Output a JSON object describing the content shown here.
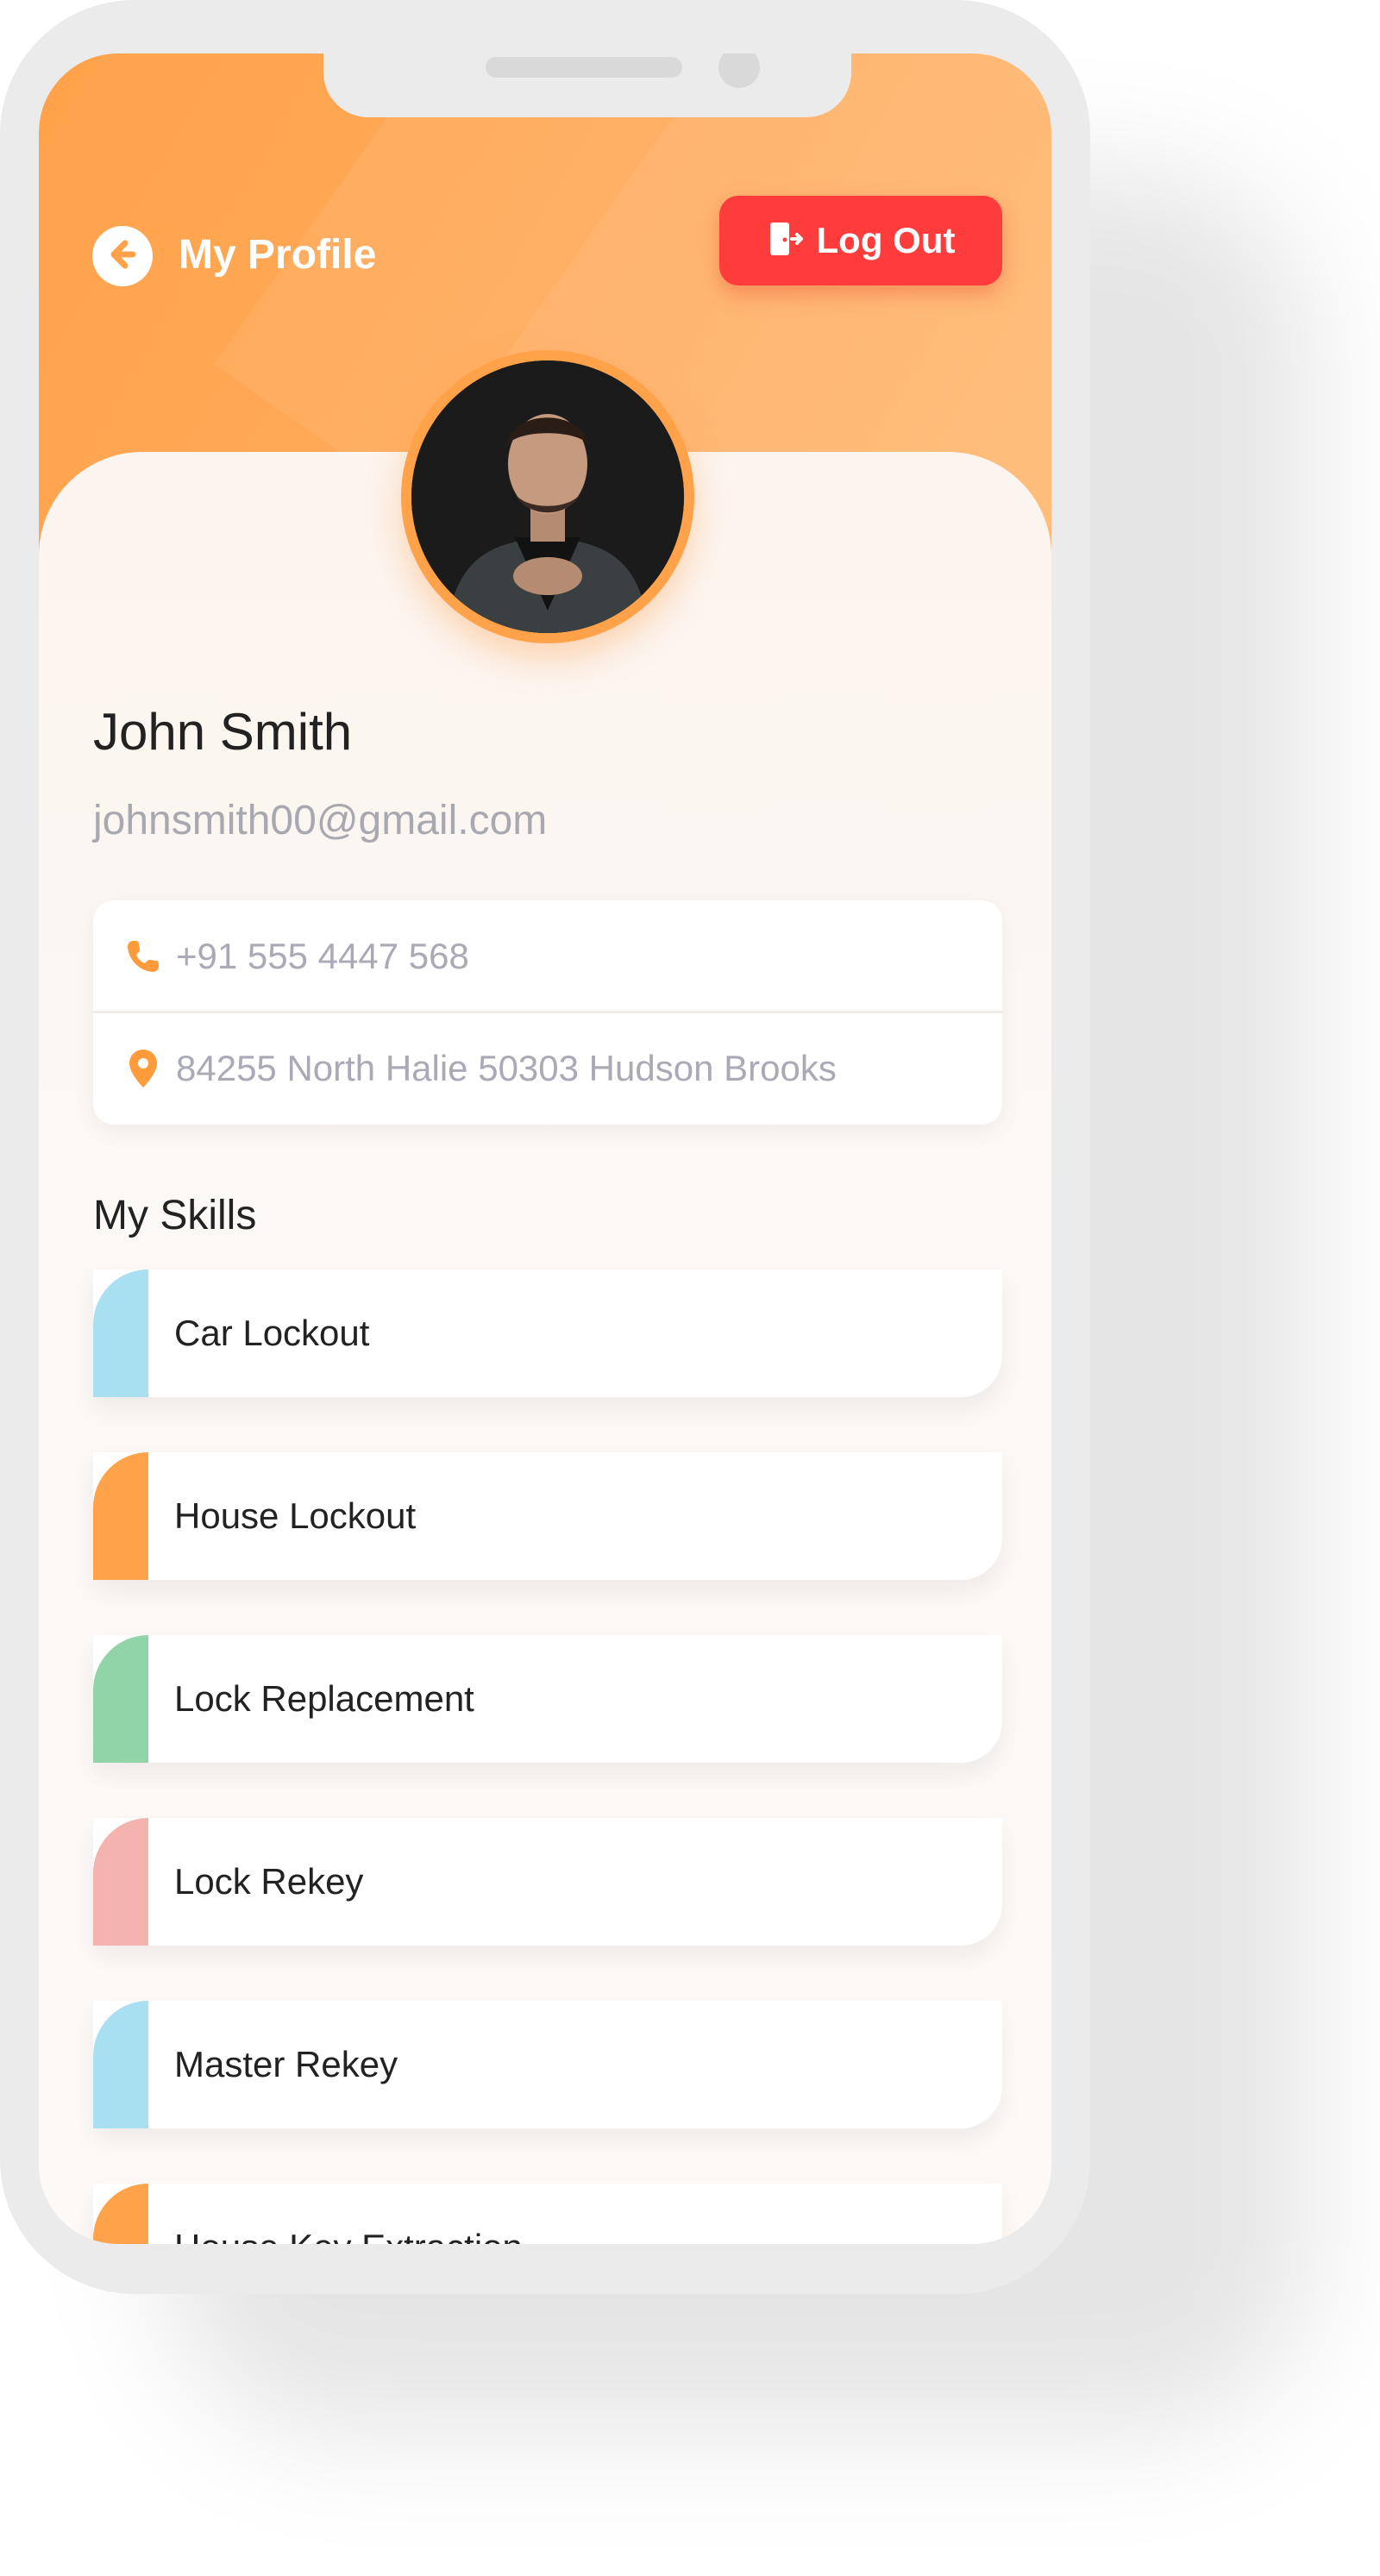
{
  "header": {
    "title": "My Profile",
    "logout_label": "Log Out"
  },
  "profile": {
    "name": "John Smith",
    "email": "johnsmith00@gmail.com",
    "phone": "+91 555 4447 568",
    "address": "84255 North Halie 50303 Hudson Brooks"
  },
  "skills": {
    "title": "My Skills",
    "items": [
      {
        "label": "Car Lockout",
        "color": "#a8e0f2"
      },
      {
        "label": "House Lockout",
        "color": "#ffa24a"
      },
      {
        "label": "Lock Replacement",
        "color": "#90d4a8"
      },
      {
        "label": "Lock Rekey",
        "color": "#f5b3b0"
      },
      {
        "label": "Master Rekey",
        "color": "#a8e0f2"
      },
      {
        "label": "House Key Extraction",
        "color": "#ffa24a"
      }
    ]
  },
  "colors": {
    "accent": "#ffa24a",
    "logout": "#ff3c3c"
  },
  "icons": {
    "back": "arrow-left-circle-icon",
    "logout": "door-exit-icon",
    "phone": "phone-icon",
    "location": "map-pin-icon"
  }
}
